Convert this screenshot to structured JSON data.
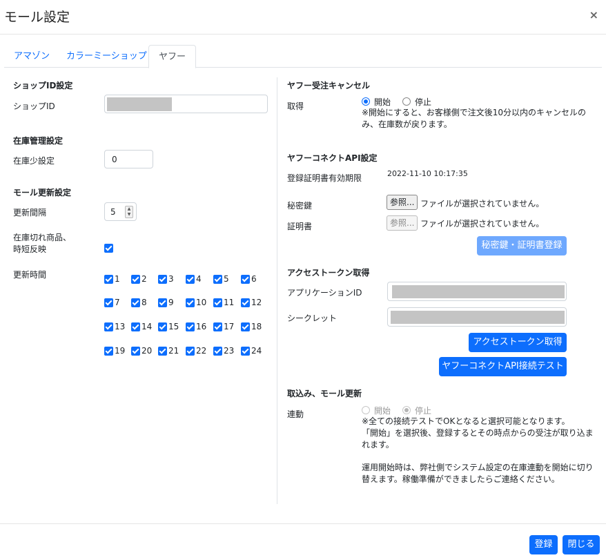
{
  "modal": {
    "title": "モール設定",
    "close": "×"
  },
  "tabs": [
    "アマゾン",
    "カラーミーショップ",
    "ヤフー"
  ],
  "left": {
    "shop_section": "ショップID設定",
    "shop_id_label": "ショップID",
    "stock_section": "在庫管理設定",
    "low_stock_label": "在庫少設定",
    "low_stock_value": "0",
    "update_section": "モール更新設定",
    "interval_label": "更新間隔",
    "interval_value": "5",
    "out_of_stock_label_line1": "在庫切れ商品、",
    "out_of_stock_label_line2": "時短反映",
    "update_time_label": "更新時間",
    "hours": [
      "1",
      "2",
      "3",
      "4",
      "5",
      "6",
      "7",
      "8",
      "9",
      "10",
      "11",
      "12",
      "13",
      "14",
      "15",
      "16",
      "17",
      "18",
      "19",
      "20",
      "21",
      "22",
      "23",
      "24"
    ]
  },
  "right": {
    "cancel_section": "ヤフー受注キャンセル",
    "get_label": "取得",
    "radio_start": "開始",
    "radio_stop": "停止",
    "cancel_note_line1": "※開始にすると、お客様側で注文後10分以内のキャンセルの",
    "cancel_note_line2": "み、在庫数が戻ります。",
    "api_section": "ヤフーコネクトAPI設定",
    "cert_expiry_label": "登録証明書有効期限",
    "cert_expiry_value": "2022-11-10 10:17:35",
    "secret_key_label": "秘密鍵",
    "certificate_label": "証明書",
    "browse_label": "参照...",
    "no_file_text": "ファイルが選択されていません。",
    "register_cert_button": "秘密鍵・証明書登録",
    "token_section": "アクセストークン取得",
    "app_id_label": "アプリケーションID",
    "secret_label": "シークレット",
    "get_token_button": "アクセストークン取得",
    "connect_test_button": "ヤフーコネクトAPI接続テスト",
    "import_section": "取込み、モール更新",
    "link_label": "連動",
    "link_note_line1": "※全ての接続テストでOKとなると選択可能となります。",
    "link_note_line2": "「開始」を選択後、登録するとその時点からの受注が取り込ま",
    "link_note_line3": "れます。",
    "link_note_line4": "運用開始時は、弊社側でシステム設定の在庫連動を開始に切り",
    "link_note_line5": "替えます。稼働準備ができましたらご連絡ください。"
  },
  "footer": {
    "register_button": "登録",
    "close_button": "閉じる"
  }
}
